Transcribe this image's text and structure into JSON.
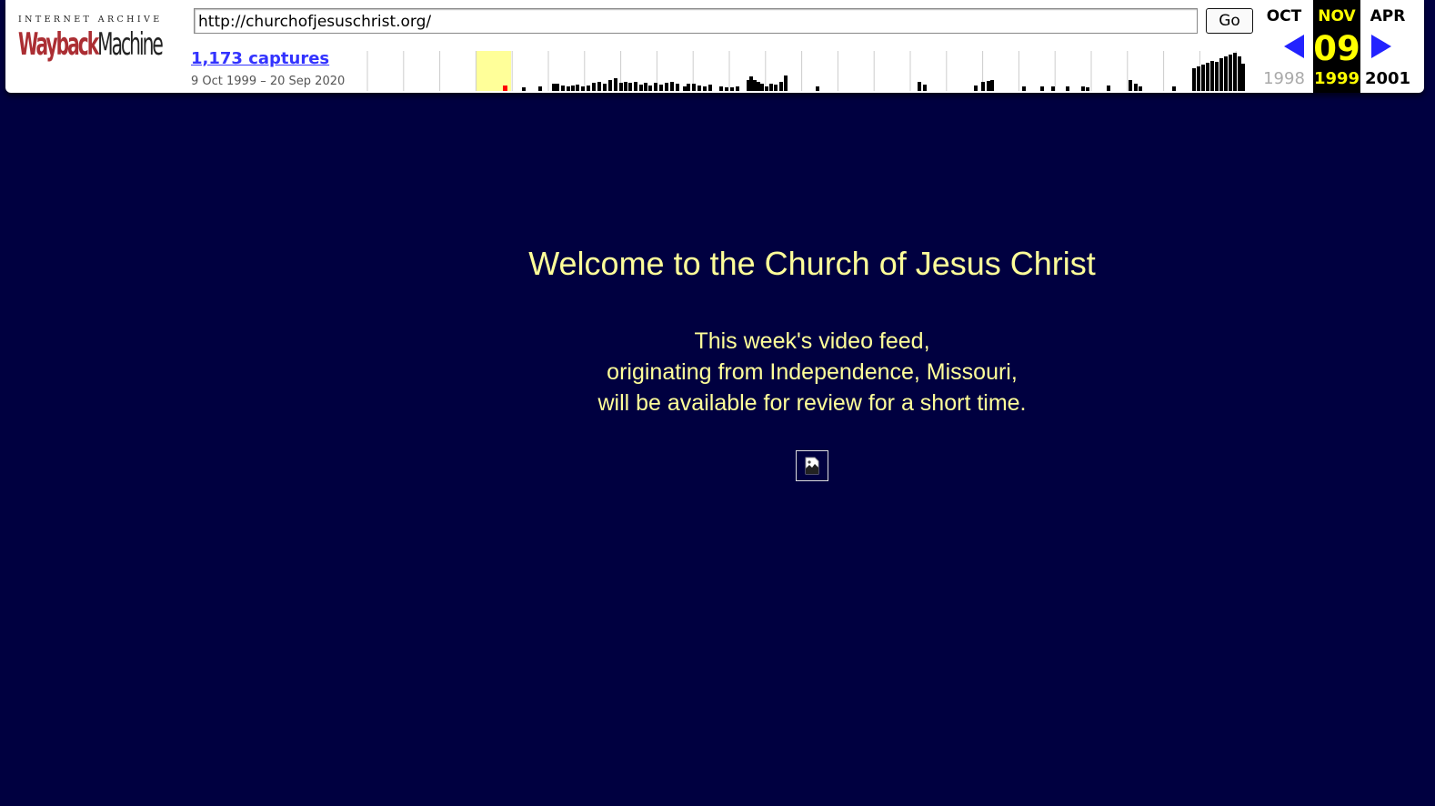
{
  "toolbar": {
    "logo_top": "INTERNET ARCHIVE",
    "logo_wayback": "Wayback",
    "logo_machine": "Machine",
    "url": "http://churchofjesuschrist.org/",
    "go_label": "Go",
    "captures": "1,173 captures",
    "range": "9 Oct 1999 – 20 Sep 2020"
  },
  "calendar": {
    "prev": {
      "month": "OCT",
      "year": "1998"
    },
    "current": {
      "month": "NOV",
      "day": "09",
      "year": "1999"
    },
    "next": {
      "month": "APR",
      "year": "2001"
    }
  },
  "page": {
    "title": "Welcome to the Church of Jesus Christ",
    "line1": "This week's video feed,",
    "line2": "originating from Independence, Missouri,",
    "line3": "will be available for review for a short time."
  },
  "colors": {
    "background": "#000040",
    "text": "#ffff99",
    "calendar_highlight": "#ffff00",
    "arrows": "#2222ff"
  }
}
